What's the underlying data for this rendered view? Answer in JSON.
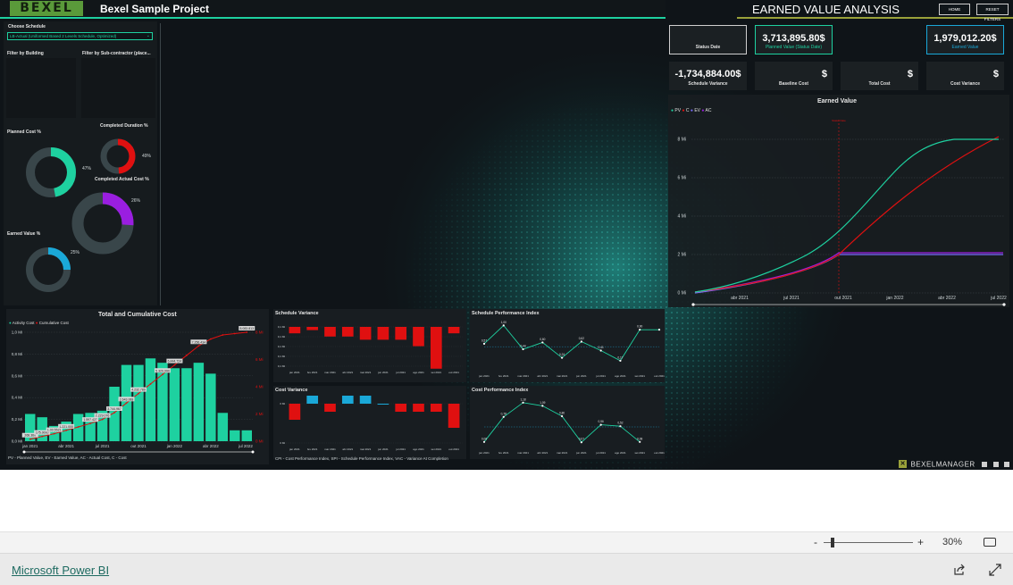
{
  "report": {
    "logo": "BEXEL",
    "project_title": "Bexel Sample Project",
    "page_title": "EARNED VALUE ANALYSIS",
    "home_button": "HOME",
    "reset_button": "RESET FILTERS",
    "brand_footer": "BEXELMANAGER",
    "colors": {
      "accent": "#1ed1a0",
      "red": "#e01010",
      "purple": "#9a1ee0",
      "blue": "#1aa8d8",
      "ring_bg": "#39464a"
    }
  },
  "filters": {
    "schedule_label": "Choose Schedule",
    "schedule_value": "LB-Actual (Uniformed Based 2 Levels Schedule, Optimized)",
    "building_label": "Filter by Building",
    "subcontractor_label": "Filter by Sub-contractor (place..."
  },
  "gauges": {
    "planned_cost": {
      "label": "Planned Cost %",
      "value_label": "47%",
      "value": 47
    },
    "completed_duration": {
      "label": "Completed Duration %",
      "value_label": "49%",
      "value": 49
    },
    "completed_actual_cost": {
      "label": "Completed Actual Cost %",
      "value_label": "26%",
      "value": 26
    },
    "earned_value": {
      "label": "Earned Value %",
      "value_label": "25%",
      "value": 25
    }
  },
  "kpis": {
    "status_date": {
      "value": "",
      "label": "Status Date"
    },
    "planned_value": {
      "value": "3,713,895.80$",
      "label": "Planned Value (Status Date)"
    },
    "earned_value": {
      "value": "1,979,012.20$",
      "label": "Earned Value"
    },
    "schedule_variance": {
      "value": "-1,734,884.00$",
      "label": "Schedule Variance"
    },
    "baseline_cost": {
      "value": "$",
      "label": "Baseline Cost"
    },
    "total_cost": {
      "value": "$",
      "label": "Total Cost"
    },
    "cost_variance": {
      "value": "$",
      "label": "Cost Variance"
    }
  },
  "earned_value_chart": {
    "title": "Earned Value",
    "legend": [
      "PV",
      "C",
      "EV",
      "AC"
    ],
    "colors": [
      "#1ed1a0",
      "#e01010",
      "#7a6cff",
      "#9a1ee0"
    ],
    "status_marker": "Status Date",
    "y_ticks": [
      "0 Mi",
      "2 Mi",
      "4 Mi",
      "6 Mi",
      "8 Mi"
    ],
    "x_ticks": [
      "abr 2021",
      "jul 2021",
      "out 2021",
      "jan 2022",
      "abr 2022",
      "jul 2022"
    ]
  },
  "chart_data": [
    {
      "type": "bar",
      "title": "Total and Cumulative Cost",
      "legend": [
        "Activity Cost",
        "Cumulative Cost"
      ],
      "categories": [
        "jan 2021",
        "fev 2021",
        "mar 2021",
        "abr 2021",
        "mai 2021",
        "jun 2021",
        "jul 2021",
        "ago 2021",
        "set 2021",
        "out 2021",
        "nov 2021",
        "dez 2021",
        "jan 2022",
        "fev 2022",
        "mar 2022",
        "abr 2022",
        "mai 2022",
        "jun 2022",
        "jul 2022"
      ],
      "x_ticks": [
        "jan 2021",
        "abr 2021",
        "jul 2021",
        "out 2021",
        "jan 2022",
        "abr 2022",
        "jul 2022"
      ],
      "y_ticks_left": [
        "0,0 Mi",
        "0,2 Mi",
        "0,4 Mi",
        "0,6 Mi",
        "0,8 Mi",
        "1,0 Mi"
      ],
      "y_ticks_right": [
        "0 Mi",
        "2 Mi",
        "4 Mi",
        "6 Mi",
        "8 Mi"
      ],
      "series": [
        {
          "name": "Activity Cost",
          "values": [
            0.25,
            0.22,
            0.14,
            0.18,
            0.25,
            0.26,
            0.28,
            0.5,
            0.7,
            0.7,
            0.76,
            0.72,
            0.67,
            0.67,
            0.72,
            0.62,
            0.26,
            0.1,
            0.1
          ]
        },
        {
          "name": "Cumulative Cost",
          "values": [
            0.15,
            0.35,
            0.55,
            0.8,
            1.05,
            1.3,
            1.6,
            2.1,
            2.8,
            3.5,
            4.2,
            4.9,
            5.6,
            6.3,
            7.0,
            7.5,
            7.8,
            7.9,
            8.0
          ]
        }
      ],
      "data_labels": [
        "268.360",
        "175.0000",
        "1.00.5521",
        "1.221.000",
        "1.597.427",
        "2.229.076",
        "3.744.967",
        "2.643.068",
        "4.232.789",
        "5.329.994",
        "6.444.724",
        "7.256.434",
        "8.083.813"
      ]
    },
    {
      "type": "bar",
      "title": "Schedule Variance",
      "categories": [
        "jan 2021",
        "fev 2021",
        "mar 2021",
        "abr 2021",
        "mai 2021",
        "jun 2021",
        "jul 2021",
        "ago 2021",
        "set 2021",
        "out 2021"
      ],
      "values": [
        -0.02,
        -0.01,
        -0.03,
        -0.03,
        -0.04,
        -0.04,
        -0.04,
        -0.06,
        -0.13,
        -0.02
      ],
      "y_ticks": [
        "0,1 Mi",
        "0,1 Mi",
        "0,1 Mi",
        "0,1 Mi",
        "0,1 Mi"
      ]
    },
    {
      "type": "line",
      "title": "Schedule Performance Index",
      "categories": [
        "jan 2021",
        "fev 2021",
        "mar 2021",
        "abr 2021",
        "mai 2021",
        "jun 2021",
        "jul 2021",
        "ago 2021",
        "set 2021",
        "out 2021"
      ],
      "values": [
        0.57,
        1.0,
        0.44,
        0.6,
        0.24,
        0.62,
        0.41,
        0.17,
        0.9,
        0.9
      ],
      "labels": [
        "0,57",
        "1,00",
        "0,44",
        "0,60",
        "0,24",
        "0,62",
        "0,41",
        "0,17",
        "0,90"
      ]
    },
    {
      "type": "bar",
      "title": "Cost Variance",
      "categories": [
        "jan 2021",
        "fev 2021",
        "mar 2021",
        "abr 2021",
        "mai 2021",
        "jun 2021",
        "jul 2021",
        "ago 2021",
        "set 2021",
        "out 2021"
      ],
      "values": [
        -0.02,
        0.01,
        -0.01,
        0.01,
        0.01,
        0.0,
        -0.01,
        -0.01,
        -0.01,
        -0.03
      ],
      "y_ticks": [
        "0 Mi",
        "0 Mi"
      ]
    },
    {
      "type": "line",
      "title": "Cost Performance Index",
      "categories": [
        "jan 2021",
        "fev 2021",
        "mar 2021",
        "abr 2021",
        "mai 2021",
        "jun 2021",
        "jul 2021",
        "ago 2021",
        "set 2021",
        "out 2021"
      ],
      "values": [
        0.08,
        0.78,
        1.18,
        1.09,
        0.8,
        0.07,
        0.56,
        0.52,
        0.08
      ],
      "labels": [
        "0,08",
        "0,78",
        "1,18",
        "1,09",
        "0,80",
        "0,07",
        "0,56",
        "0,52",
        "0,08"
      ]
    }
  ],
  "footnotes": {
    "left": "PV - Planned Value, EV - Earned Value, AC - Actual Cost, C - Cost",
    "right": "CPI - Cost Performance Index, SPI - Schedule Performance Index, VAC - Variance At Completion"
  },
  "zoom": {
    "minus": "-",
    "plus": "+",
    "percent": "30%"
  },
  "footer": {
    "link": "Microsoft Power BI"
  }
}
